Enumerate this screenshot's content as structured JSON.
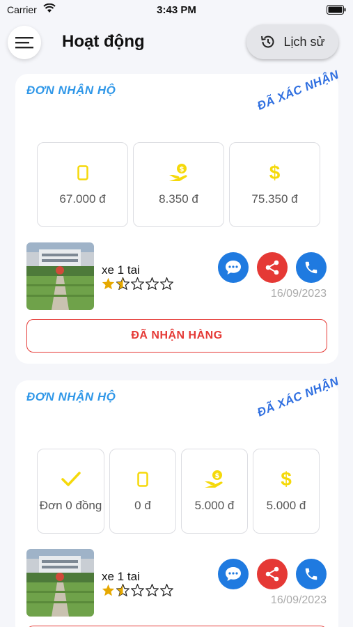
{
  "status_bar": {
    "carrier": "Carrier",
    "time": "3:43 PM"
  },
  "header": {
    "title": "Hoạt động",
    "history_label": "Lịch sử"
  },
  "cards": [
    {
      "type_label": "ĐƠN NHẬN HỘ",
      "stamp": "ĐÃ XÁC NHẬN",
      "tiles": [
        {
          "icon": "phone-device-icon",
          "value": "67.000 đ"
        },
        {
          "icon": "hand-coin-icon",
          "value": "8.350 đ"
        },
        {
          "icon": "dollar-icon",
          "value": "75.350 đ"
        }
      ],
      "vehicle": "xe 1 tai",
      "rating": 1.5,
      "date": "16/09/2023",
      "action_label": "ĐÃ NHẬN HÀNG"
    },
    {
      "type_label": "ĐƠN NHẬN HỘ",
      "stamp": "ĐÃ XÁC NHẬN",
      "tiles": [
        {
          "icon": "check-icon",
          "value": "Đơn 0 đồng"
        },
        {
          "icon": "phone-device-icon",
          "value": "0 đ"
        },
        {
          "icon": "hand-coin-icon",
          "value": "5.000 đ"
        },
        {
          "icon": "dollar-icon",
          "value": "5.000 đ"
        }
      ],
      "vehicle": "xe 1 tai",
      "rating": 1.5,
      "date": "16/09/2023"
    }
  ],
  "colors": {
    "accent_blue": "#2f97e8",
    "stamp_blue": "#2f6fe0",
    "chat_blue": "#1f7ae0",
    "share_red": "#e53935",
    "icon_yellow": "#f5d90a",
    "star_yellow": "#e6a800"
  }
}
